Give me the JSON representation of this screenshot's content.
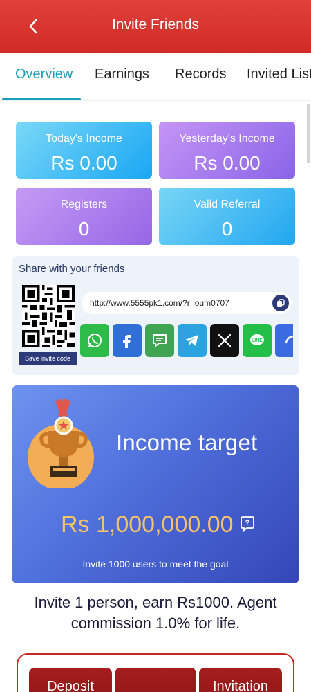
{
  "header": {
    "title": "Invite Friends"
  },
  "tabs": [
    {
      "label": "Overview",
      "active": true
    },
    {
      "label": "Earnings",
      "active": false
    },
    {
      "label": "Records",
      "active": false
    },
    {
      "label": "Invited List",
      "active": false
    }
  ],
  "stats": {
    "today": {
      "label": "Today's Income",
      "value": "Rs 0.00"
    },
    "yesterday": {
      "label": "Yesterday's Income",
      "value": "Rs 0.00"
    },
    "registers": {
      "label": "Registers",
      "value": "0"
    },
    "valid_referral": {
      "label": "Valid Referral",
      "value": "0"
    }
  },
  "share": {
    "title": "Share with your friends",
    "save_code_label": "Save invite code",
    "link": "http://www.5555pk1.com/?r=oum0707",
    "socials": [
      {
        "icon": "whatsapp-icon",
        "color": "#2fbb4a"
      },
      {
        "icon": "facebook-icon",
        "color": "#2f6fd6"
      },
      {
        "icon": "sms-icon",
        "color": "#3fa552"
      },
      {
        "icon": "telegram-icon",
        "color": "#2aa3e0"
      },
      {
        "icon": "x-icon",
        "color": "#111111"
      },
      {
        "icon": "line-icon",
        "color": "#24bf48"
      },
      {
        "icon": "more-icon",
        "color": "#3b6be0"
      }
    ]
  },
  "target": {
    "title": "Income target",
    "amount": "Rs 1,000,000.00",
    "subtitle": "Invite 1000 users to meet the goal"
  },
  "invite_text": "Invite 1 person, earn Rs1000. Agent commission 1.0% for life.",
  "bottom_buttons": [
    {
      "label": "Deposit"
    },
    {
      "label": ""
    },
    {
      "label": "Invitation"
    }
  ],
  "colors": {
    "header_red": "#d8332e",
    "tab_active": "#1a9fb8",
    "target_amount": "#f5c16a",
    "button_dark_red": "#9a1a1a"
  }
}
